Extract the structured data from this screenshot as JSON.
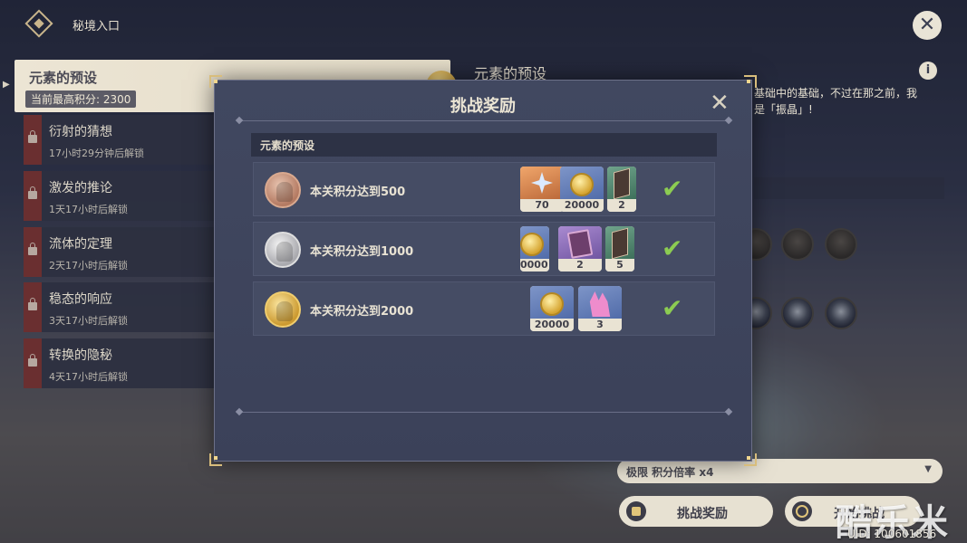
{
  "header": {
    "title": "秘境入口"
  },
  "stages": [
    {
      "name": "元素的预设",
      "score_label": "当前最高积分: 2300",
      "active": true
    },
    {
      "name": "衍射的猜想",
      "unlock": "17小时29分钟后解锁"
    },
    {
      "name": "激发的推论",
      "unlock": "1天17小时后解锁"
    },
    {
      "name": "流体的定理",
      "unlock": "2天17小时后解锁"
    },
    {
      "name": "稳态的响应",
      "unlock": "3天17小时后解锁"
    },
    {
      "name": "转换的隐秘",
      "unlock": "4天17小时后解锁"
    }
  ],
  "detail": {
    "title": "元素的预设",
    "desc_line1": "基础中的基础，不过在那之前，我",
    "desc_line2": "是「振晶」!"
  },
  "difficulty": {
    "label": "极限 积分倍率 x4"
  },
  "buttons": {
    "reward": "挑战奖励",
    "second": "开始挑战"
  },
  "watermark": "酷乐米",
  "uid": "UID: 100601856",
  "modal": {
    "title": "挑战奖励",
    "section": "元素的预设",
    "rows": [
      {
        "medal": "bronze",
        "requirement": "本关积分达到500",
        "items": [
          {
            "icon": "primogem-icon",
            "qty": "70"
          },
          {
            "icon": "mora-icon",
            "qty": "20000"
          },
          {
            "icon": "slab-icon",
            "qty": "2"
          }
        ],
        "claimed": true
      },
      {
        "medal": "silver",
        "requirement": "本关积分达到1000",
        "items": [
          {
            "icon": "mora-icon",
            "qty": "0000"
          },
          {
            "icon": "book-icon",
            "qty": "2"
          },
          {
            "icon": "slab-icon",
            "qty": "5"
          }
        ],
        "claimed": true
      },
      {
        "medal": "gold",
        "requirement": "本关积分达到2000",
        "items": [
          {
            "icon": "mora-icon",
            "qty": "20000"
          },
          {
            "icon": "crystal-icon",
            "qty": "3"
          }
        ],
        "claimed": true
      }
    ]
  },
  "colors": {
    "accent_gold": "#d8bd7c",
    "check_green": "#8ccc52",
    "lock_red": "#6a2f30"
  }
}
